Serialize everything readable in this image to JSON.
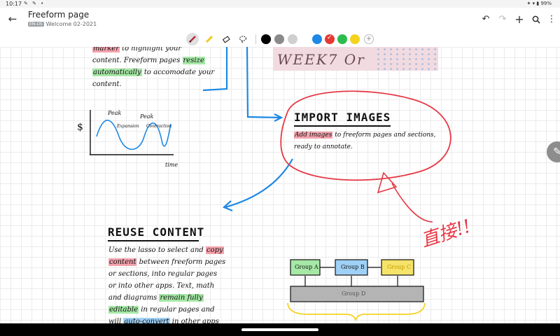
{
  "status_bar": {
    "time": "10:17",
    "icons_left": "✎ ✎ •",
    "battery": "✦ ▾ ▮ 99%"
  },
  "app_bar": {
    "title": "Freeform page",
    "tag": "EN-US",
    "subtitle": "Welcome 02-2021",
    "actions": [
      "undo",
      "redo",
      "add",
      "search",
      "more"
    ]
  },
  "toolbar": {
    "tools": [
      "pen",
      "highlighter",
      "eraser",
      "lasso"
    ],
    "active_tool": "pen",
    "colors": [
      "#000000",
      "#8a8a8a",
      "#cfcfcf",
      "#1e88e5",
      "#e53935",
      "#2dbb4e",
      "#f5d21f"
    ],
    "selected_color": "#e53935"
  },
  "notes": {
    "top_para": [
      {
        "text": "marker",
        "hl": "red",
        "suffix": " to highlight your"
      },
      {
        "text": "content. Freeform pages ",
        "hl": "",
        "suffix": ""
      },
      {
        "text": "automatically",
        "hl": "green",
        "suffix": " to accomodate your"
      },
      {
        "text": "content.",
        "hl": "",
        "suffix": ""
      }
    ],
    "resize_word": "resize",
    "chart_labels": {
      "dollar": "$",
      "peak1": "Peak",
      "peak2": "Peak",
      "expansion": "Expansion",
      "contraction": "Contraction",
      "time": "time"
    },
    "import_heading": "IMPORT IMAGES",
    "import_line1_hl": "Add images",
    "import_line1_rest": " to freeform pages and sections,",
    "import_line2": "ready to annotate.",
    "reuse_heading": "REUSE CONTENT",
    "reuse_lines": [
      {
        "a": "Use the lasso to select and ",
        "h": "copy",
        "hl": "red",
        "b": ""
      },
      {
        "a": "",
        "h": "content",
        "hl": "red",
        "b": " between freeform pages"
      },
      {
        "a": "or sections, into regular pages",
        "h": "",
        "hl": "",
        "b": ""
      },
      {
        "a": "or into other apps. Text, math",
        "h": "",
        "hl": "",
        "b": ""
      },
      {
        "a": "and diagrams ",
        "h": "remain fully",
        "hl": "green",
        "b": ""
      },
      {
        "a": "",
        "h": "editable",
        "hl": "green",
        "b": " in regular pages and"
      },
      {
        "a": "will ",
        "h": "auto-convert",
        "hl": "blue",
        "b": " in other apps"
      }
    ],
    "groups": {
      "a": "Group A",
      "b": "Group B",
      "c": "Group C",
      "d": "Group D"
    },
    "red_scribble": "直接!!",
    "photo_text": "WEEK7 Or"
  },
  "fab_icon": "pencil-icon"
}
